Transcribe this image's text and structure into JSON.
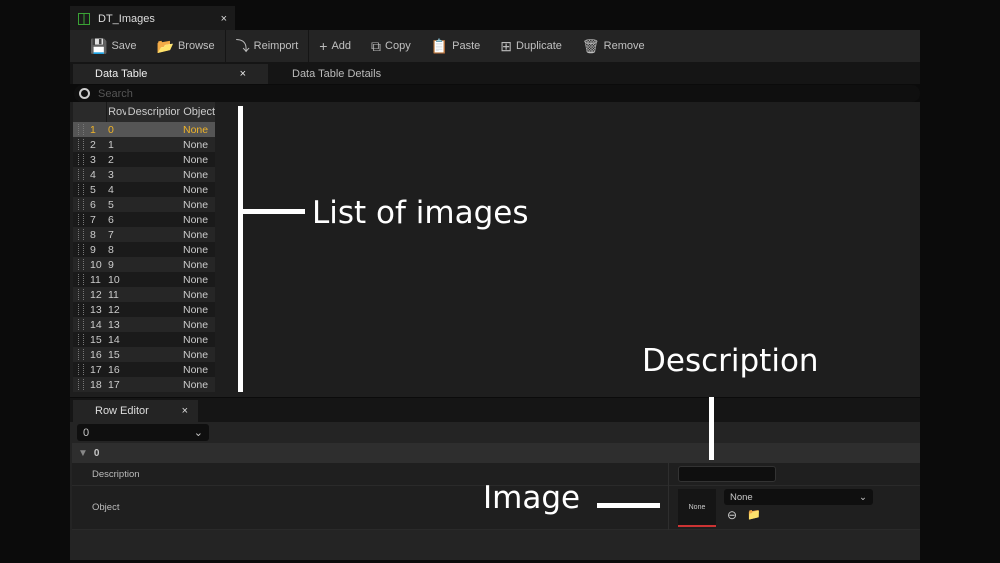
{
  "document_tab": {
    "title": "DT_Images",
    "close": "×"
  },
  "toolbar": [
    {
      "label": "Save",
      "icon": "💾"
    },
    {
      "label": "Browse",
      "icon": "📂"
    },
    {
      "label": "Reimport",
      "icon": "⤵"
    },
    {
      "label": "Add",
      "icon": "+"
    },
    {
      "label": "Copy",
      "icon": "⧉"
    },
    {
      "label": "Paste",
      "icon": "📋"
    },
    {
      "label": "Duplicate",
      "icon": "⊞"
    },
    {
      "label": "Remove",
      "icon": "🗑"
    }
  ],
  "panel_tabs": {
    "data_table": "Data Table",
    "close": "×",
    "details": "Data Table Details"
  },
  "search": {
    "placeholder": "Search"
  },
  "table": {
    "headers": [
      "Rov",
      "Description",
      "Object"
    ],
    "rows": [
      [
        "1",
        "0",
        "None"
      ],
      [
        "2",
        "1",
        "None"
      ],
      [
        "3",
        "2",
        "None"
      ],
      [
        "4",
        "3",
        "None"
      ],
      [
        "5",
        "4",
        "None"
      ],
      [
        "6",
        "5",
        "None"
      ],
      [
        "7",
        "6",
        "None"
      ],
      [
        "8",
        "7",
        "None"
      ],
      [
        "9",
        "8",
        "None"
      ],
      [
        "10",
        "9",
        "None"
      ],
      [
        "11",
        "10",
        "None"
      ],
      [
        "12",
        "11",
        "None"
      ],
      [
        "13",
        "12",
        "None"
      ],
      [
        "14",
        "13",
        "None"
      ],
      [
        "15",
        "14",
        "None"
      ],
      [
        "16",
        "15",
        "None"
      ],
      [
        "17",
        "16",
        "None"
      ],
      [
        "18",
        "17",
        "None"
      ]
    ]
  },
  "row_editor": {
    "tab": "Row Editor",
    "close": "×",
    "selected_row": "0",
    "category": "0",
    "description_label": "Description",
    "object_label": "Object",
    "thumbnail": "None",
    "object_value": "None"
  },
  "annotations": {
    "list": "List of images",
    "description": "Description",
    "image": "Image"
  },
  "colors": {
    "selected_text": "#f0b429",
    "accent_green": "#3aa335",
    "thumb_underline": "#c33333"
  }
}
